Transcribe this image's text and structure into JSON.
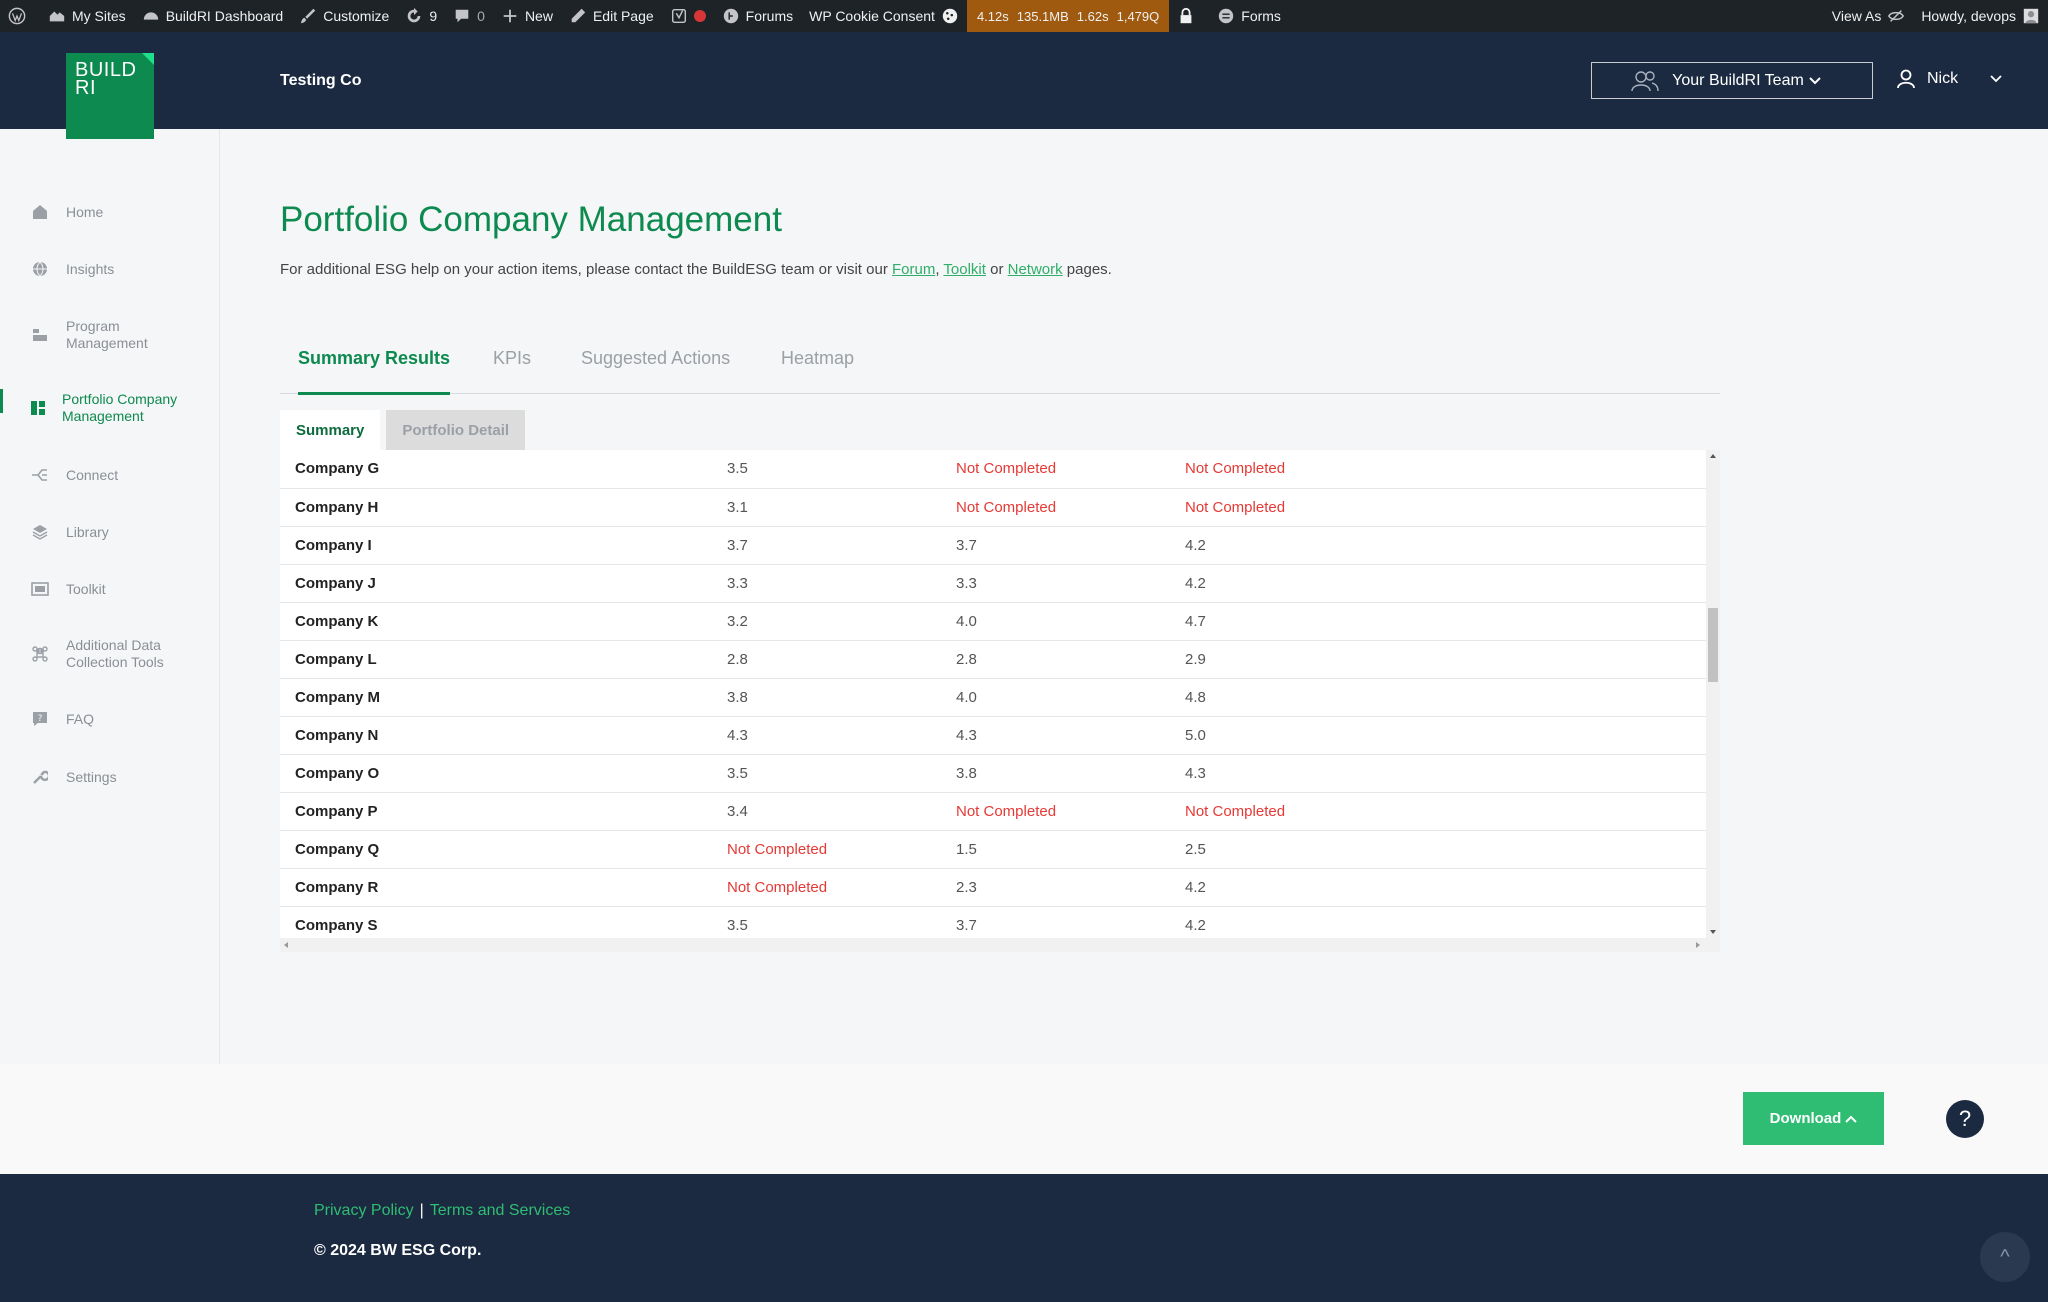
{
  "adminbar": {
    "my_sites": "My Sites",
    "dashboard": "BuildRI Dashboard",
    "customize": "Customize",
    "updates_count": "9",
    "comments_count": "0",
    "new": "New",
    "edit_page": "Edit Page",
    "forums": "Forums",
    "cookie_consent": "WP Cookie Consent",
    "perf": [
      "4.12s",
      "135.1MB",
      "1.62s",
      "1,479Q"
    ],
    "forms": "Forms",
    "view_as": "View As",
    "howdy": "Howdy, devops"
  },
  "header": {
    "logo_line1": "BUILD",
    "logo_line2": "RI",
    "company": "Testing Co",
    "team_button": "Your BuildRI Team",
    "user": "Nick"
  },
  "sidebar": {
    "items": [
      {
        "label": "Home",
        "icon": "home-icon"
      },
      {
        "label": "Insights",
        "icon": "globe-icon"
      },
      {
        "label": "Program Management",
        "icon": "program-icon"
      },
      {
        "label": "Portfolio Company Management",
        "icon": "dashboard-icon"
      },
      {
        "label": "Connect",
        "icon": "connect-icon"
      },
      {
        "label": "Library",
        "icon": "layers-icon"
      },
      {
        "label": "Toolkit",
        "icon": "toolkit-icon"
      },
      {
        "label": "Additional Data Collection Tools",
        "icon": "command-icon"
      },
      {
        "label": "FAQ",
        "icon": "faq-icon"
      },
      {
        "label": "Settings",
        "icon": "wrench-icon"
      }
    ]
  },
  "main": {
    "title": "Portfolio Company Management",
    "help_prefix": "For additional ESG help on your action items, please contact the BuildESG team or visit our ",
    "help_forum": "Forum",
    "help_comma": ", ",
    "help_toolkit": "Toolkit",
    "help_or": " or ",
    "help_network": "Network",
    "help_suffix": " pages.",
    "tabs": [
      "Summary Results",
      "KPIs",
      "Suggested Actions",
      "Heatmap"
    ],
    "subtabs": [
      "Summary",
      "Portfolio Detail"
    ],
    "rows": [
      [
        "Company G",
        "3.5",
        "Not Completed",
        "Not Completed"
      ],
      [
        "Company H",
        "3.1",
        "Not Completed",
        "Not Completed"
      ],
      [
        "Company I",
        "3.7",
        "3.7",
        "4.2"
      ],
      [
        "Company J",
        "3.3",
        "3.3",
        "4.2"
      ],
      [
        "Company K",
        "3.2",
        "4.0",
        "4.7"
      ],
      [
        "Company L",
        "2.8",
        "2.8",
        "2.9"
      ],
      [
        "Company M",
        "3.8",
        "4.0",
        "4.8"
      ],
      [
        "Company N",
        "4.3",
        "4.3",
        "5.0"
      ],
      [
        "Company O",
        "3.5",
        "3.8",
        "4.3"
      ],
      [
        "Company P",
        "3.4",
        "Not Completed",
        "Not Completed"
      ],
      [
        "Company Q",
        "Not Completed",
        "1.5",
        "2.5"
      ],
      [
        "Company R",
        "Not Completed",
        "2.3",
        "4.2"
      ],
      [
        "Company S",
        "3.5",
        "3.7",
        "4.2"
      ]
    ]
  },
  "actions": {
    "download": "Download",
    "help": "?"
  },
  "footer": {
    "privacy": "Privacy Policy",
    "separator": "|",
    "terms": "Terms and Services",
    "copyright": "© 2024 BW ESG Corp.",
    "scroll_top": "^"
  },
  "colors": {
    "brand_green": "#0d8a4f",
    "navy": "#1b2a41",
    "not_completed_red": "#e53935",
    "download_green": "#2ebd72"
  }
}
